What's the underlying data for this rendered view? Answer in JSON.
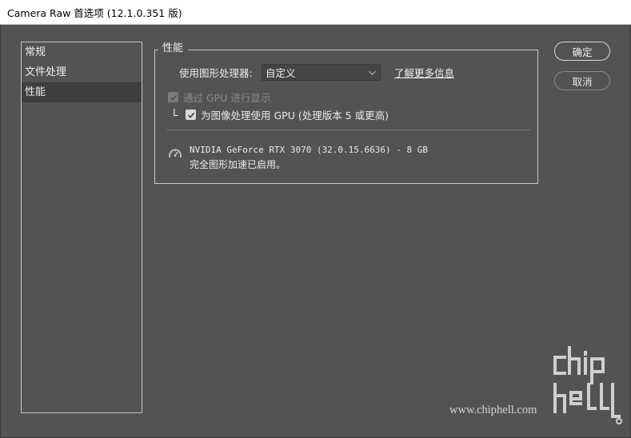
{
  "window": {
    "title": "Camera Raw 首选项 (12.1.0.351 版)"
  },
  "sidebar": {
    "items": [
      {
        "label": "常规",
        "selected": false
      },
      {
        "label": "文件处理",
        "selected": false
      },
      {
        "label": "性能",
        "selected": true
      }
    ]
  },
  "panel": {
    "legend": "性能",
    "gpu_label": "使用图形处理器:",
    "gpu_select_value": "自定义",
    "learn_more_link": "了解更多信息",
    "option_display": {
      "label": "通过 GPU 进行显示",
      "checked": true,
      "disabled": true
    },
    "option_image": {
      "label": "为图像处理使用 GPU (处理版本 5 或更高)",
      "checked": true,
      "disabled": false
    },
    "bracket_glyph": "L",
    "gpu_name": "NVIDIA GeForce RTX 3070 (32.0.15.6636) - 8 GB",
    "gpu_status": "完全图形加速已启用。",
    "status_icon": "gauge-icon"
  },
  "buttons": {
    "ok": "确定",
    "cancel": "取消"
  },
  "watermark": {
    "text": "www.chiphell.com",
    "logo": "chiphell-logo"
  }
}
